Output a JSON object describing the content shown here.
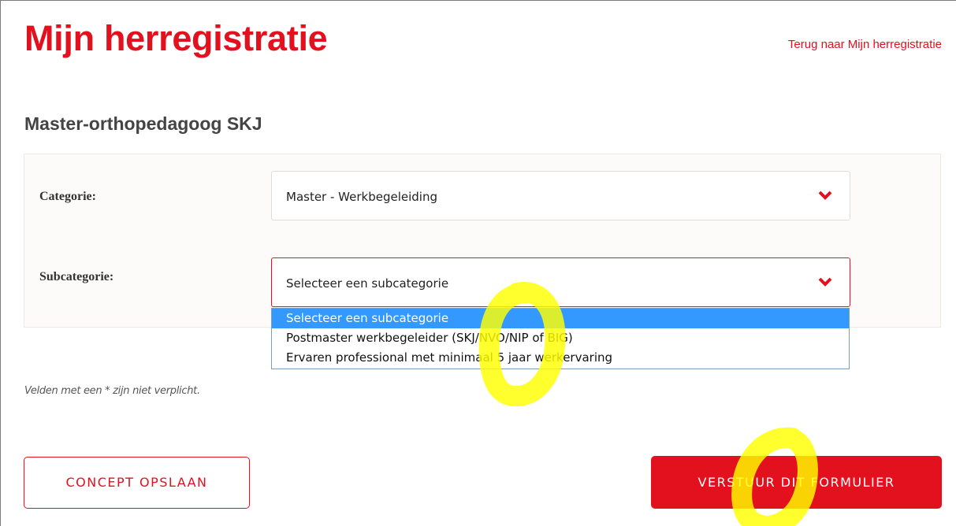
{
  "header": {
    "title": "Mijn herregistratie",
    "back_link": "Terug naar Mijn herregistratie"
  },
  "section": {
    "title": "Master-orthopedagoog SKJ"
  },
  "form": {
    "category": {
      "label": "Categorie:",
      "value": "Master - Werkbegeleiding"
    },
    "subcategory": {
      "label": "Subcategorie:",
      "value": "Selecteer een subcategorie",
      "options": [
        "Selecteer een subcategorie",
        "Postmaster werkbegeleider (SKJ/NVO/NIP of BIG)",
        "Ervaren professional met minimaal 5 jaar werkervaring"
      ],
      "selected_index": 0
    },
    "footnote": "Velden met een * zijn niet verplicht."
  },
  "actions": {
    "save_concept": "CONCEPT OPSLAAN",
    "submit": "VERSTUUR DIT FORMULIER"
  },
  "colors": {
    "brand_red": "#e3101e",
    "option_highlight": "#3399ff",
    "annotation_highlight": "#ffff00"
  },
  "icons": {
    "dropdown": "chevron-down-icon"
  }
}
